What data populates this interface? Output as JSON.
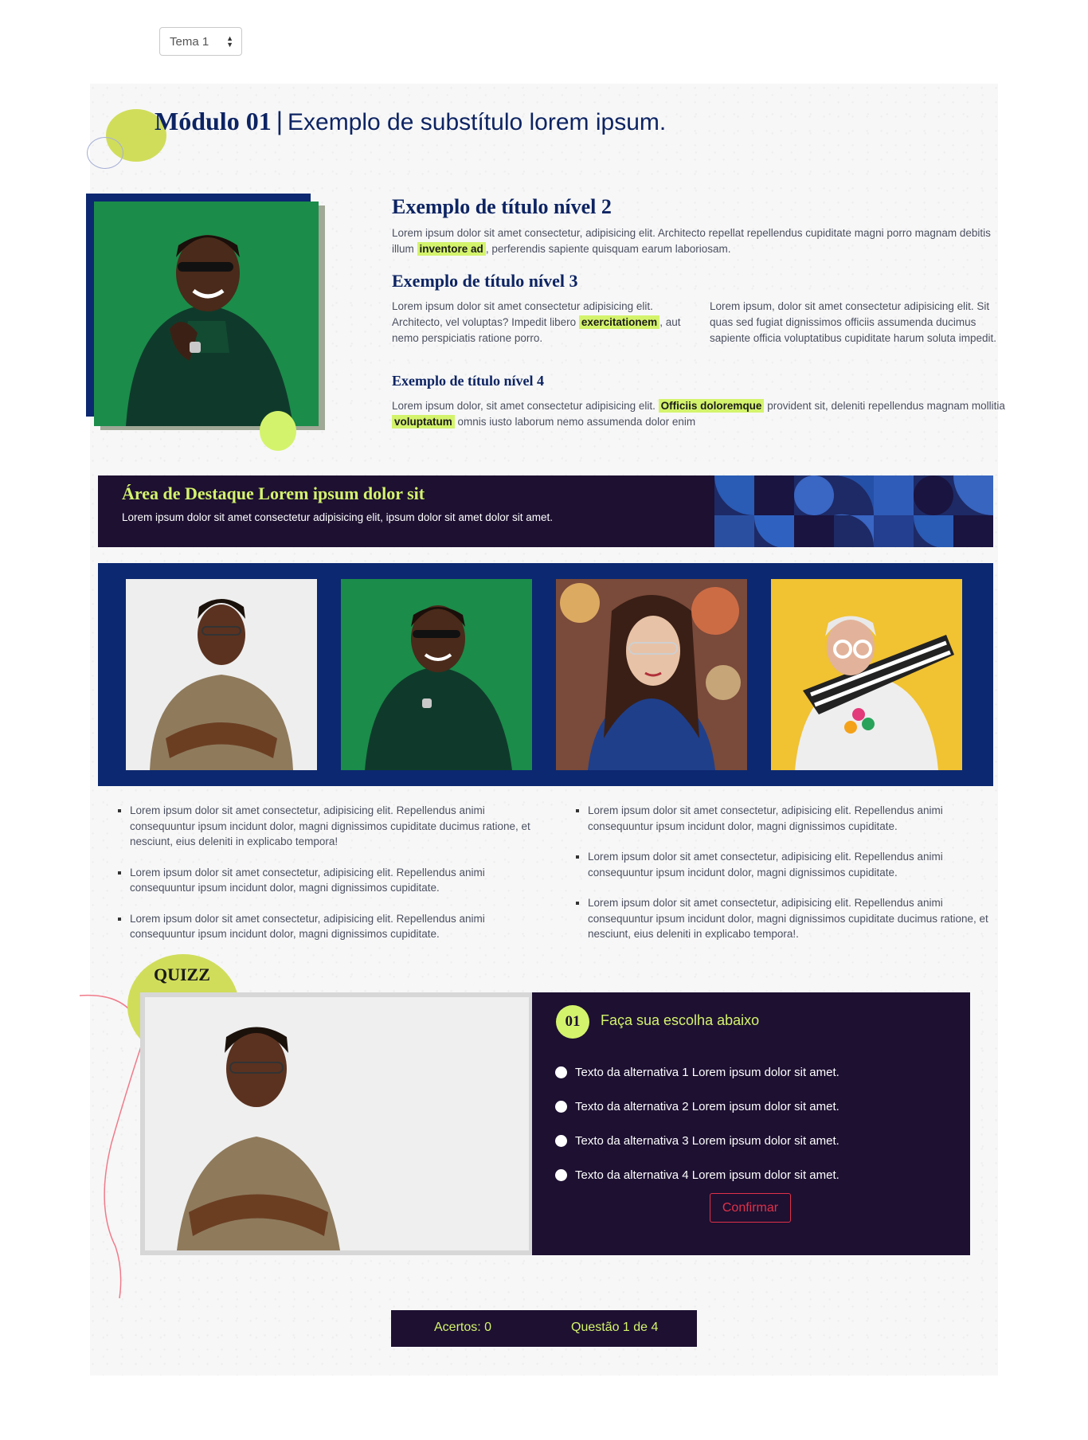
{
  "theme_select": {
    "value": "Tema 1"
  },
  "header": {
    "module_bold": "Módulo 01",
    "separator": "|",
    "subtitle": "Exemplo de substítulo lorem ipsum."
  },
  "content": {
    "h2": "Exemplo de título nível 2",
    "p1_a": "Lorem ipsum dolor sit amet consectetur, adipisicing elit. Architecto repellat repellendus cupiditate magni porro magnam debitis illum",
    "p1_hl": "inventore ad",
    "p1_b": ", perferendis sapiente quisquam earum laboriosam.",
    "h3": "Exemplo de título nível 3",
    "p3a_a": "Lorem ipsum dolor sit amet consectetur adipisicing elit. Architecto, vel voluptas? Impedit libero",
    "p3a_hl": "exercitationem",
    "p3a_b": ", aut nemo perspiciatis ratione porro.",
    "p3b": "Lorem ipsum, dolor sit amet consectetur adipisicing elit. Sit quas sed fugiat dignissimos officiis assumenda ducimus sapiente officia voluptatibus cupiditate harum soluta impedit.",
    "h4": "Exemplo de título nível 4",
    "p4_a": "Lorem ipsum dolor, sit amet consectetur adipisicing elit.",
    "p4_hl1": "Officiis doloremque",
    "p4_b": "provident sit, deleniti repellendus magnam mollitia",
    "p4_hl2": "voluptatum",
    "p4_c": "omnis iusto laborum nemo assumenda dolor enim"
  },
  "highlight": {
    "title": "Área de Destaque Lorem ipsum dolor sit",
    "text": "Lorem ipsum dolor sit amet consectetur adipisicing elit, ipsum dolor sit amet dolor sit amet."
  },
  "lists": {
    "left": [
      "Lorem ipsum dolor sit amet consectetur, adipisicing elit. Repellendus animi consequuntur ipsum incidunt dolor, magni dignissimos cupiditate ducimus ratione, et nesciunt, eius deleniti in explicabo tempora!",
      "Lorem ipsum dolor sit amet consectetur, adipisicing elit. Repellendus animi consequuntur ipsum incidunt dolor, magni dignissimos cupiditate.",
      "Lorem ipsum dolor sit amet consectetur, adipisicing elit. Repellendus animi consequuntur ipsum incidunt dolor, magni dignissimos cupiditate."
    ],
    "right": [
      "Lorem ipsum dolor sit amet consectetur, adipisicing elit. Repellendus animi consequuntur ipsum incidunt dolor, magni dignissimos cupiditate.",
      "Lorem ipsum dolor sit amet consectetur, adipisicing elit. Repellendus animi consequuntur ipsum incidunt dolor, magni dignissimos cupiditate.",
      "Lorem ipsum dolor sit amet consectetur, adipisicing elit. Repellendus animi consequuntur ipsum incidunt dolor, magni dignissimos cupiditate ducimus ratione, et nesciunt, eius deleniti in explicabo tempora!."
    ]
  },
  "quiz": {
    "label": "QUIZZ",
    "number": "01",
    "title": "Faça sua escolha abaixo",
    "options": [
      "Texto da alternativa 1 Lorem ipsum dolor sit amet.",
      "Texto da alternativa 2 Lorem ipsum dolor sit amet.",
      "Texto da alternativa 3 Lorem ipsum dolor sit amet.",
      "Texto da alternativa 4 Lorem ipsum dolor sit amet."
    ],
    "confirm_label": "Confirmar"
  },
  "score": {
    "hits": "Acertos: 0",
    "progress": "Questão 1 de 4"
  },
  "colors": {
    "navy": "#0c2870",
    "dark_purple": "#1d1031",
    "lime": "#d4f36c",
    "confirm_red": "#e0314a"
  }
}
